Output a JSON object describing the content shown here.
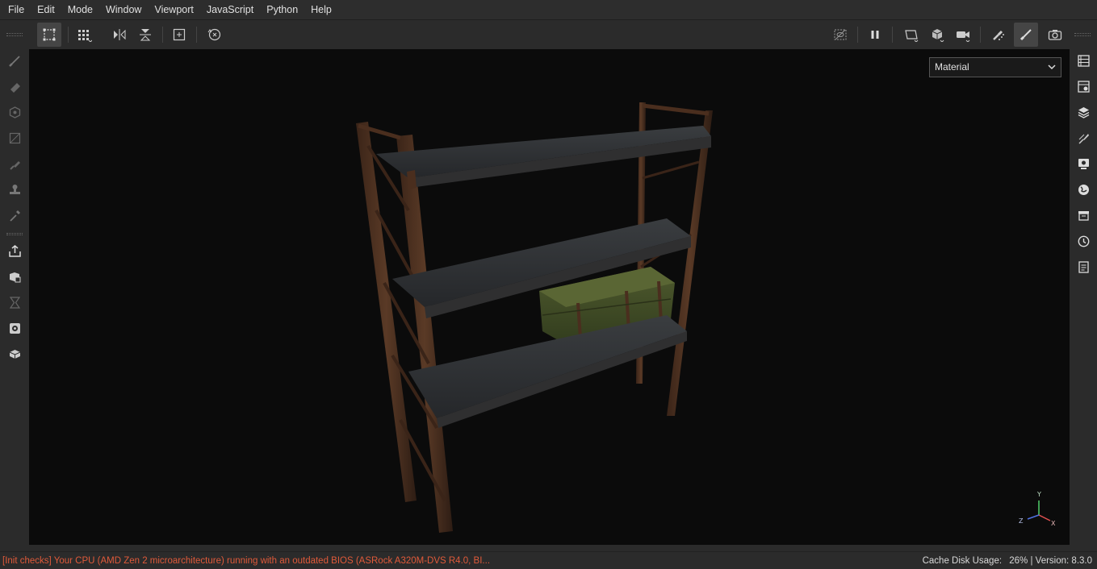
{
  "menu": [
    "File",
    "Edit",
    "Mode",
    "Window",
    "Viewport",
    "JavaScript",
    "Python",
    "Help"
  ],
  "toolbar": {
    "left_icons": [
      "select-polygon-icon",
      "grid-symmetry-icon",
      "mirror-x-icon",
      "mirror-y-icon",
      "add-frame-icon",
      "reset-rotation-icon"
    ],
    "right_icons": [
      "hide-occlusion-icon",
      "pause-icon",
      "2d-view-icon",
      "3d-cube-icon",
      "camera-icon",
      "paint-sprayer-icon",
      "brush-icon",
      "screenshot-icon"
    ]
  },
  "left_tools": [
    "paint-brush-icon",
    "eraser-icon",
    "projection-icon",
    "geometry-mask-icon",
    "smudge-icon",
    "clone-stamp-icon",
    "color-picker-icon",
    "export-icon",
    "bake-icon",
    "iray-icon",
    "texture-set-icon",
    "mesh-icon"
  ],
  "right_panels": [
    "layers-list-icon",
    "texture-settings-icon",
    "layers-stack-icon",
    "properties-icon",
    "display-settings-icon",
    "environment-icon",
    "shelf-icon",
    "history-icon",
    "log-icon"
  ],
  "viewport": {
    "mode_select": "Material",
    "axis": {
      "y": "Y",
      "x": "X",
      "z": "Z"
    }
  },
  "status": {
    "message": "[Init checks] Your CPU (AMD Zen 2 microarchitecture) running with an outdated BIOS (ASRock A320M-DVS R4.0, BI...",
    "cache_label": "Cache Disk Usage:",
    "cache_value": "26%",
    "version_label": "Version: 8.3.0"
  },
  "colors": {
    "status_error": "#e05a3a",
    "viewport_bg": "#0b0b0b",
    "panel_bg": "#2b2b2b"
  }
}
